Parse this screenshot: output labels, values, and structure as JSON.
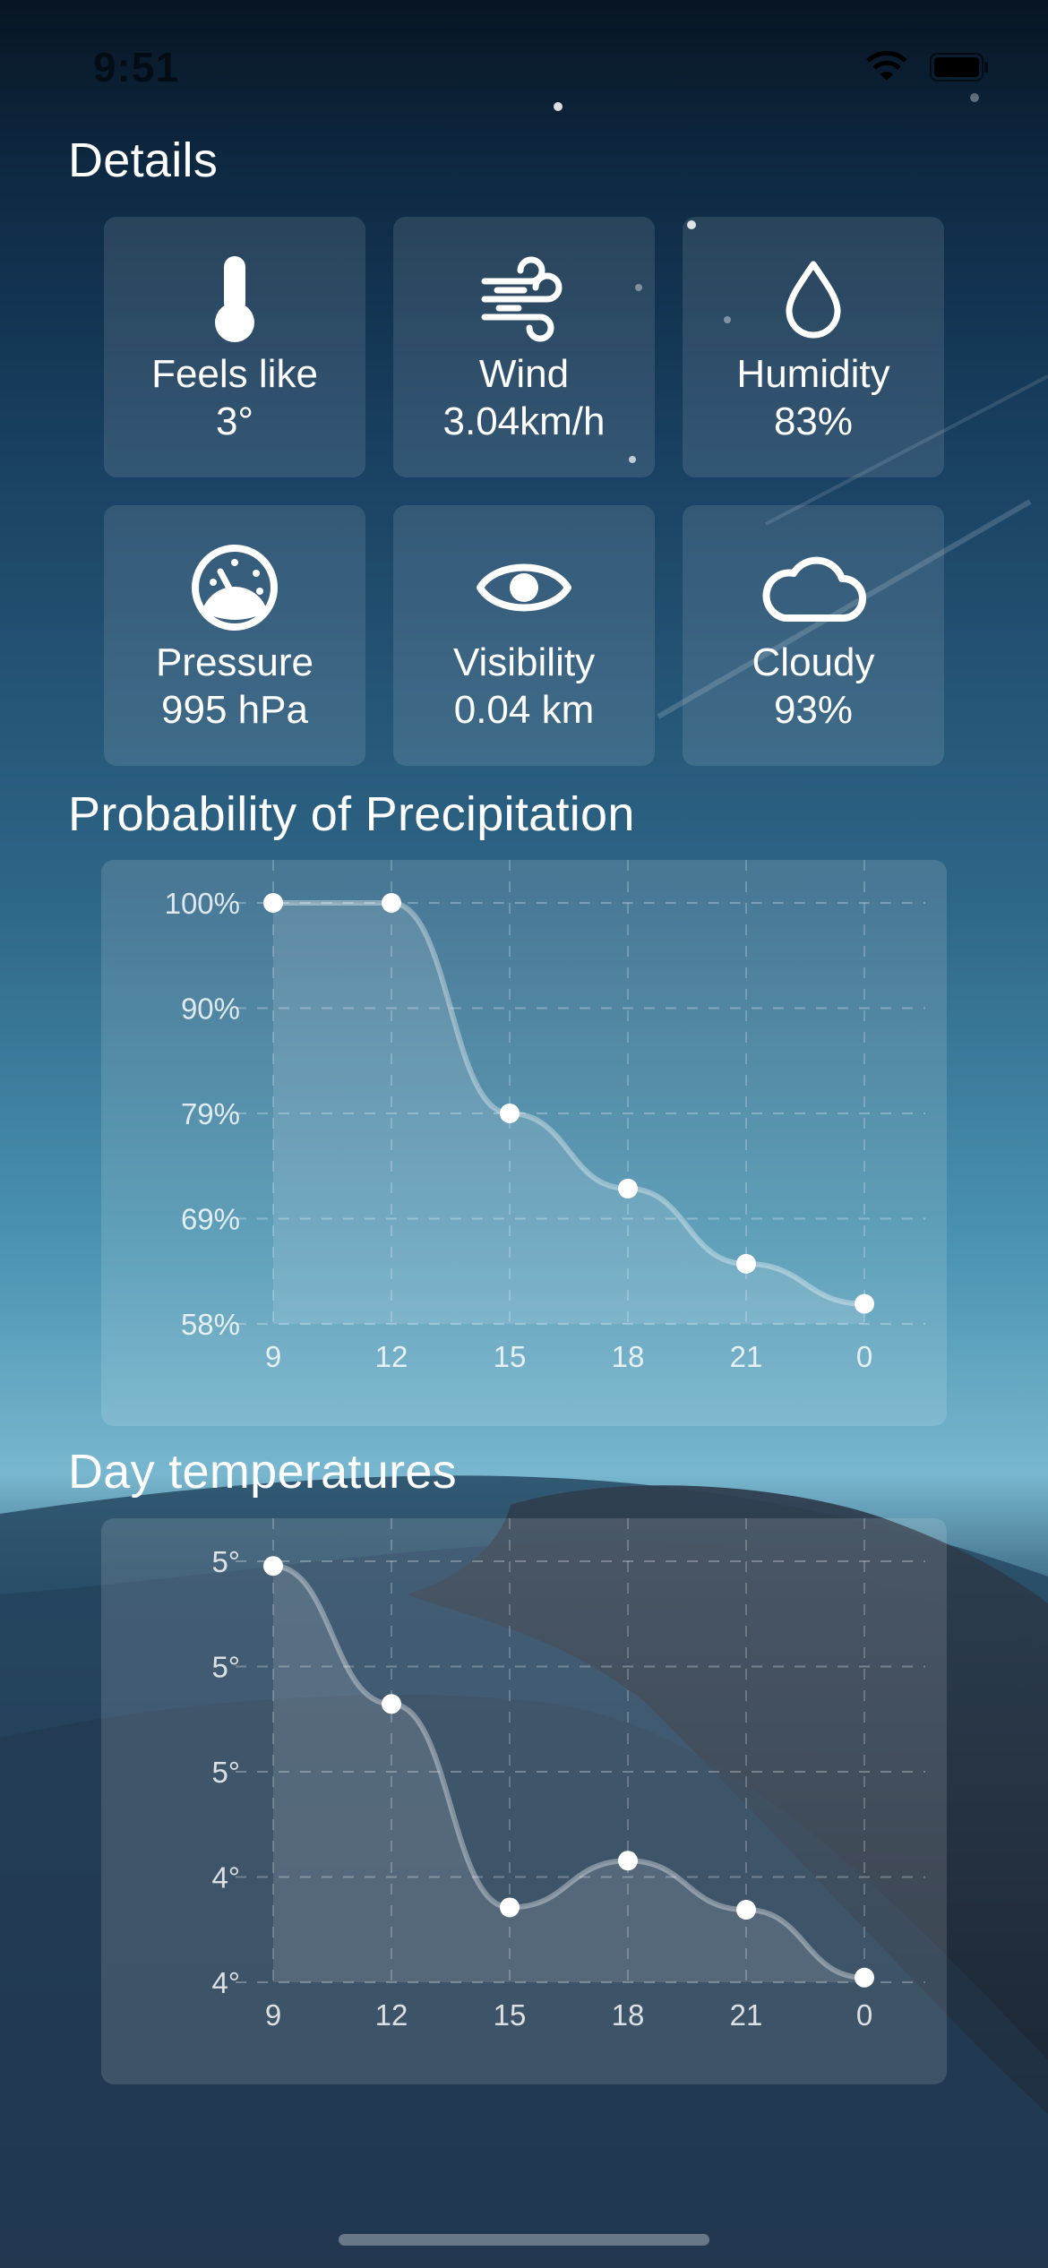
{
  "status": {
    "time": "9:51"
  },
  "details": {
    "title": "Details",
    "tiles": [
      {
        "icon": "thermometer-icon",
        "label": "Feels like",
        "value": "3°"
      },
      {
        "icon": "wind-icon",
        "label": "Wind",
        "value": "3.04km/h"
      },
      {
        "icon": "droplet-icon",
        "label": "Humidity",
        "value": "83%"
      },
      {
        "icon": "gauge-icon",
        "label": "Pressure",
        "value": "995 hPa"
      },
      {
        "icon": "eye-icon",
        "label": "Visibility",
        "value": "0.04 km"
      },
      {
        "icon": "cloud-icon",
        "label": "Cloudy",
        "value": "93%"
      }
    ]
  },
  "precipitation": {
    "title": "Probability of Precipitation"
  },
  "temperatures": {
    "title": "Day temperatures"
  },
  "chart_data": [
    {
      "type": "line",
      "title": "Probability of Precipitation",
      "categories": [
        "9",
        "12",
        "15",
        "18",
        "21",
        "0"
      ],
      "y_tick_labels": [
        "100%",
        "90%",
        "79%",
        "69%",
        "58%"
      ],
      "ylim": [
        58,
        100
      ],
      "series": [
        {
          "values": [
            100,
            100,
            79,
            71.5,
            64,
            60
          ]
        }
      ],
      "grid": true,
      "area_fill": true
    },
    {
      "type": "line",
      "title": "Day temperatures",
      "categories": [
        "9",
        "12",
        "15",
        "18",
        "21",
        "0"
      ],
      "y_tick_labels": [
        "5°",
        "5°",
        "5°",
        "4°",
        "4°"
      ],
      "ylim": [
        3.6,
        5.4
      ],
      "series": [
        {
          "values": [
            5.38,
            4.79,
            3.92,
            4.12,
            3.91,
            3.62
          ]
        }
      ],
      "grid": true,
      "area_fill": true
    }
  ]
}
